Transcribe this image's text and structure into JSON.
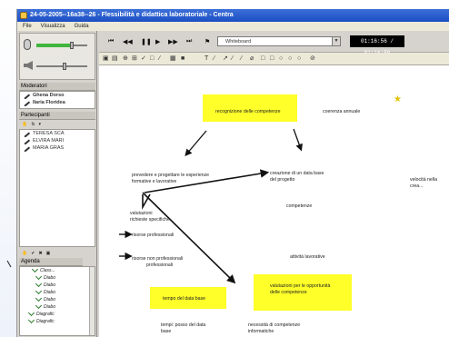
{
  "window": {
    "title": "24-05-2005--16a38--26 - Flessibilità e didattica laboratoriale - Centra"
  },
  "menu": {
    "items": [
      "File",
      "Visualizza",
      "Guida"
    ]
  },
  "colors": {
    "titlebar": "#1c4fc4",
    "highlight": "#ffff2a",
    "volume": "#41b63d",
    "star": "#e0c200"
  },
  "audio": {
    "mic_level": 0.7,
    "speaker_level": 0.55
  },
  "moderators": {
    "header": "Moderatori",
    "items": [
      {
        "label": "Ghena Dorso"
      },
      {
        "label": "Ilaria Floridea"
      }
    ]
  },
  "participants": {
    "header": "Partecipanti",
    "items": [
      {
        "label": "TERESA SCA"
      },
      {
        "label": "ELVIRA MARI"
      },
      {
        "label": "MARIA GRAS"
      }
    ]
  },
  "agenda": {
    "header": "Agenda",
    "items": [
      {
        "label": "Class..."
      },
      {
        "label": "Diabo"
      },
      {
        "label": "Diabo"
      },
      {
        "label": "Diabo"
      },
      {
        "label": "Diabo"
      },
      {
        "label": "Diabo"
      },
      {
        "label": "Diagrafic"
      },
      {
        "label": "Diagrafic"
      }
    ]
  },
  "media": {
    "buttons": [
      {
        "name": "skip-back",
        "glyph": "⏮"
      },
      {
        "name": "rewind",
        "glyph": "◀◀"
      },
      {
        "name": "pause",
        "glyph": "❚❚"
      },
      {
        "name": "play",
        "glyph": "▶"
      },
      {
        "name": "fast-forward",
        "glyph": "▶▶"
      },
      {
        "name": "skip-forward",
        "glyph": "⏭"
      }
    ],
    "select_value": "Whiteboard",
    "time": "01:16:56 / 01:16:56"
  },
  "whiteboard": {
    "notes": {
      "n1": "recognizione delle competenze",
      "n2": "coerenza annuale",
      "n3": "prevedere e progettare le esperienze",
      "n3b": "formative e lavorative",
      "n4": "creazione di un data base",
      "n4b": "del progetto",
      "n5": "velocità nella crea...",
      "n6": "valutazioni",
      "n6b": "richieste specifiche",
      "n7": "competenze",
      "n8": "risorse professionali",
      "n9": "risorse non professionali",
      "n9b": "professionali",
      "n10": "attività lavorative",
      "n11": "valutazioni per le opportunità",
      "n11b": "delle competenze",
      "n12": "tempo del data base",
      "n13": "tempi: posso del data",
      "n13b": "base",
      "n14": "necessità di competenze",
      "n14b": "informatiche"
    }
  }
}
